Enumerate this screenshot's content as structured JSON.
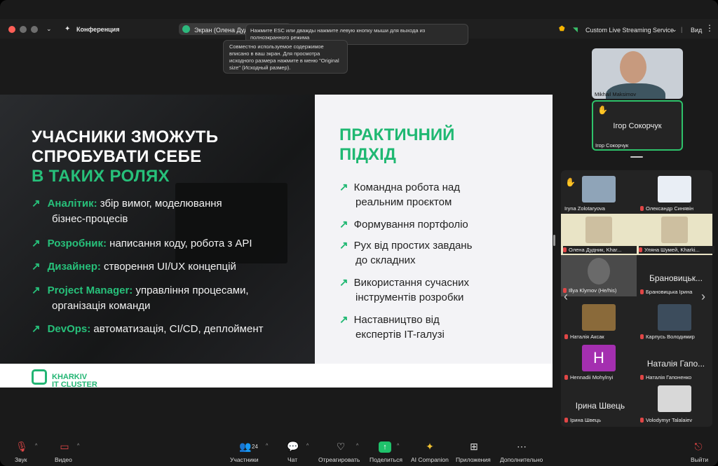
{
  "window": {
    "title": "Конференция"
  },
  "screen_share": {
    "label": "Экран (Олена Дуд"
  },
  "tooltip_esc": "Нажмите ESC или дважды нажмите левую кнопку мыши для выхода из полноэкранного режима",
  "tooltip_fit": "Совместно используемое содержимое вписано в ваш экран. Для просмотра исходного размера нажмите в меню \"Original size\" (Исходный размер).",
  "streaming": {
    "label": "Custom Live Streaming Service"
  },
  "view_button": "Вид",
  "slide": {
    "heading_lines": [
      "УЧАСНИКИ ЗМОЖУТЬ",
      "СПРОБУВАТИ СЕБЕ",
      "В ТАКИХ РОЛЯХ"
    ],
    "roles": [
      {
        "key": "Аналітик:",
        "text": " збір вимог, моделювання",
        "cont": "бізнес-процесів"
      },
      {
        "key": "Розробник:",
        "text": " написання коду, робота з API",
        "cont": ""
      },
      {
        "key": "Дизайнер:",
        "text": " створення UI/UX концепцій",
        "cont": ""
      },
      {
        "key": "Project Manager:",
        "text": " управління процесами,",
        "cont": "організація команди"
      },
      {
        "key": "DevOps:",
        "text": " автоматизація, CI/CD, деплоймент",
        "cont": ""
      }
    ],
    "right_heading_lines": [
      "ПРАКТИЧНИЙ",
      "ПІДХІД"
    ],
    "approach": [
      [
        "Командна робота над",
        "реальним проєктом"
      ],
      [
        "Формування портфоліо"
      ],
      [
        "Рух від простих завдань",
        "до складних"
      ],
      [
        "Використання сучасних",
        "інструментів розробки"
      ],
      [
        "Наставництво від",
        "експертів IT-галузі"
      ]
    ],
    "logo_lines": [
      "KHARKIV",
      "IT CLUSTER"
    ],
    "arrow": "↗"
  },
  "speakers": [
    {
      "name": "Mikhail Maksimov"
    },
    {
      "name": "Ігор Сокорчук",
      "big": "Ігор Сокорчук"
    }
  ],
  "gallery": [
    {
      "name": "Iryna Zolotaryova",
      "muted": false,
      "hand": true,
      "avatar_color": "#8fa4b8"
    },
    {
      "name": "Олександр Синявін",
      "muted": true,
      "avatar_color": "#e9eef5"
    },
    {
      "name": "Олена Дудник, Khar...",
      "muted": true,
      "avatar_color": "#e9e4c6"
    },
    {
      "name": "Уляна Шумей, Kharki...",
      "muted": true,
      "avatar_color": "#e9e4c6"
    },
    {
      "name": "Illya Klymov (He/his)",
      "muted": true,
      "avatar_color": "#5a5a5a"
    },
    {
      "name": "Брановицька Ірина",
      "muted": true,
      "big": "Брановицьк..."
    },
    {
      "name": "Наталія Аксак",
      "muted": true,
      "avatar_color": "#8a6a3a"
    },
    {
      "name": "Карпусь Володимир",
      "muted": true,
      "avatar_color": "#3c4c5c"
    },
    {
      "name": "Hennadii Mohylnyi",
      "muted": true,
      "letter": "H",
      "avatar_color": "#a42fb0"
    },
    {
      "name": "Наталія Гапоненко",
      "muted": true,
      "big": "Наталія Гапо..."
    },
    {
      "name": "Ірина Швець",
      "muted": true,
      "big": "Ірина Швець"
    },
    {
      "name": "Volodymyr Talalaiev",
      "muted": true,
      "avatar_color": "#d8d8d8"
    }
  ],
  "toolbar": {
    "audio": "Звук",
    "video": "Видео",
    "participants": "Участники",
    "participants_count": "24",
    "chat": "Чат",
    "react": "Отреагировать",
    "share": "Поделиться",
    "ai": "AI Companion",
    "apps": "Приложения",
    "more": "Дополнительно",
    "leave": "Выйти"
  },
  "colors": {
    "accent": "#27c07a",
    "share_green": "#1fc26b",
    "leave_red": "#e04646"
  }
}
